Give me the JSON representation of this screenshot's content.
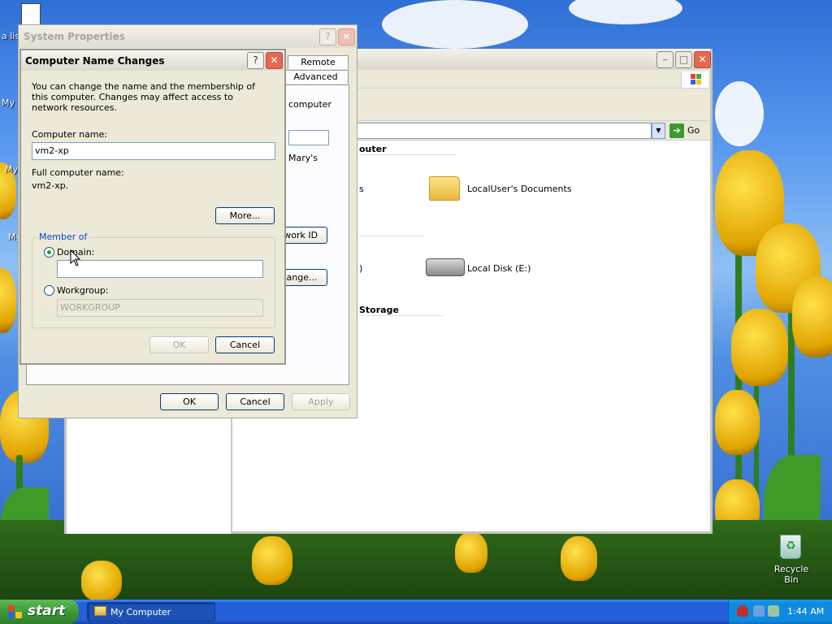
{
  "desktop": {
    "icons": [
      {
        "label": "a lis"
      },
      {
        "label": "My I"
      },
      {
        "label": "My"
      },
      {
        "label": "My"
      },
      {
        "label": "Recycle Bin"
      }
    ]
  },
  "explorer": {
    "address_go": "Go",
    "section_this_computer": "outer",
    "section_storage": "Storage",
    "items": [
      {
        "label": "s"
      },
      {
        "label": "LocalUser's Documents"
      },
      {
        "label": ")"
      },
      {
        "label": "Local Disk (E:)"
      }
    ]
  },
  "system_properties": {
    "title": "System Properties",
    "tabs": [
      "Remote",
      "Advanced"
    ],
    "partial_text": {
      "computer": "computer",
      "marys": "Mary's",
      "network_id_btn": "twork ID",
      "change_btn": "hange..."
    },
    "buttons": {
      "ok": "OK",
      "cancel": "Cancel",
      "apply": "Apply"
    }
  },
  "computer_name_changes": {
    "title": "Computer Name Changes",
    "description": "You can change the name and the membership of this computer. Changes may affect access to network resources.",
    "computer_name_label": "Computer name:",
    "computer_name_value": "vm2-xp",
    "full_name_label": "Full computer name:",
    "full_name_value": "vm2-xp.",
    "more_button": "More...",
    "member_of_label": "Member of",
    "domain_label": "Domain:",
    "domain_value": "",
    "workgroup_label": "Workgroup:",
    "workgroup_value": "WORKGROUP",
    "selected_membership": "domain",
    "ok_button": "OK",
    "cancel_button": "Cancel"
  },
  "taskbar": {
    "start_label": "start",
    "tasks": [
      {
        "label": "My Computer"
      }
    ],
    "clock": "1:44 AM"
  },
  "colors": {
    "taskbar_blue": "#245edb",
    "start_green": "#3c9b36",
    "tray_blue": "#0f8ae0",
    "dialog_face": "#ece9d8",
    "groupbox_label": "#0046d5"
  }
}
